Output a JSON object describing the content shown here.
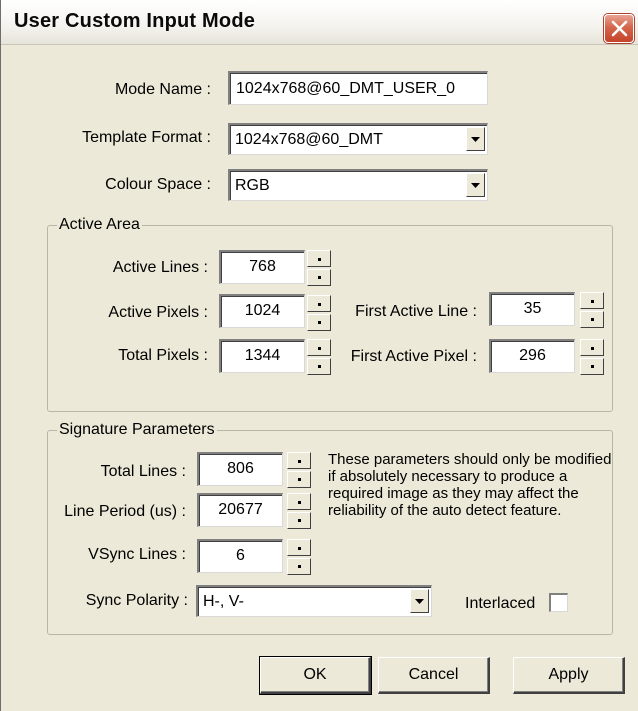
{
  "window": {
    "title": "User Custom Input Mode"
  },
  "form": {
    "mode_name_label": "Mode Name :",
    "mode_name_value": "1024x768@60_DMT_USER_0",
    "template_format_label": "Template Format :",
    "template_format_value": "1024x768@60_DMT",
    "colour_space_label": "Colour Space :",
    "colour_space_value": "RGB"
  },
  "active_area": {
    "title": "Active Area",
    "active_lines_label": "Active Lines :",
    "active_lines_value": "768",
    "active_pixels_label": "Active Pixels :",
    "active_pixels_value": "1024",
    "total_pixels_label": "Total Pixels :",
    "total_pixels_value": "1344",
    "first_active_line_label": "First Active Line :",
    "first_active_line_value": "35",
    "first_active_pixel_label": "First Active Pixel :",
    "first_active_pixel_value": "296"
  },
  "signature": {
    "title": "Signature Parameters",
    "total_lines_label": "Total Lines :",
    "total_lines_value": "806",
    "line_period_label": "Line Period (us) :",
    "line_period_value": "20677",
    "vsync_lines_label": "VSync Lines :",
    "vsync_lines_value": "6",
    "note": "These parameters should only be modified if absolutely necessary to produce a required image as they may affect the reliability of the auto detect feature.",
    "sync_polarity_label": "Sync Polarity :",
    "sync_polarity_value": "H-, V-",
    "interlaced_label": "Interlaced",
    "interlaced_checked": false
  },
  "buttons": {
    "ok": "OK",
    "cancel": "Cancel",
    "apply": "Apply"
  },
  "icons": {
    "close": "close-icon",
    "dropdown": "chevron-down-icon",
    "spin_up": "spin-up-icon",
    "spin_down": "spin-down-icon"
  }
}
